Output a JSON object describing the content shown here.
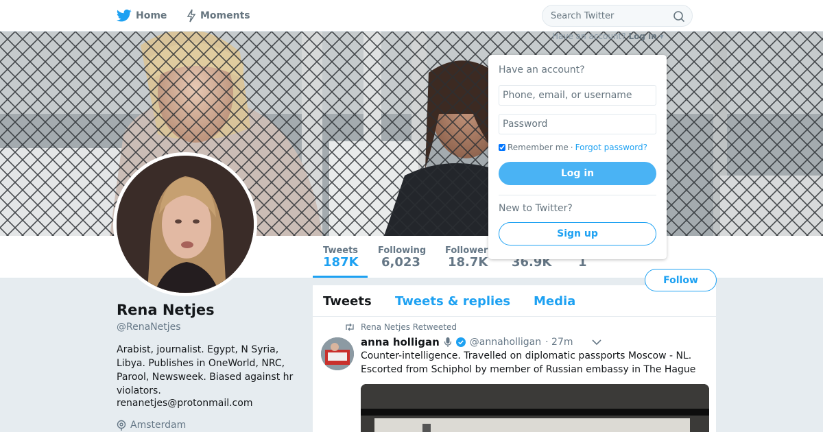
{
  "nav": {
    "home_label": "Home",
    "moments_label": "Moments",
    "home_icon": "twitter-bird-icon",
    "moments_icon": "lightning-icon"
  },
  "search": {
    "placeholder": "Search Twitter",
    "icon": "search-icon"
  },
  "header_login": {
    "prompt": "Have an account?",
    "link": "Log in"
  },
  "login_dropdown": {
    "title": "Have an account?",
    "username_placeholder": "Phone, email, or username",
    "password_placeholder": "Password",
    "remember_label": "Remember me",
    "separator": "·",
    "forgot_label": "Forgot password?",
    "login_label": "Log in",
    "new_prompt": "New to Twitter?",
    "signup_label": "Sign up"
  },
  "stats": [
    {
      "label": "Tweets",
      "value": "187K"
    },
    {
      "label": "Following",
      "value": "6,023"
    },
    {
      "label": "Followers",
      "value": "18.7K"
    },
    {
      "label": "",
      "value": "36.9K"
    },
    {
      "label": "",
      "value": "1"
    }
  ],
  "follow_label": "Follow",
  "profile": {
    "name": "Rena Netjes",
    "handle": "@RenaNetjes",
    "bio": "Arabist, journalist. Egypt, N Syria, Libya. Publishes in OneWorld, NRC, Parool, Newsweek. Biased against hr violators.",
    "email": "renanetjes@protonmail.com",
    "location": "Amsterdam"
  },
  "timeline": {
    "tabs": [
      "Tweets",
      "Tweets & replies",
      "Media"
    ],
    "retweet_note": "Rena Netjes Retweeted",
    "tweet": {
      "author_name": "anna holligan",
      "author_handle": "@annaholligan",
      "time": "· 27m",
      "text": "Counter-intelligence. Travelled on diplomatic passports Moscow - NL. Escorted from Schiphol by member of Russian embassy in The Hague"
    }
  },
  "colors": {
    "accent": "#1da1f2",
    "login_button": "#4ab3f4",
    "background": "#e6ecf0"
  }
}
